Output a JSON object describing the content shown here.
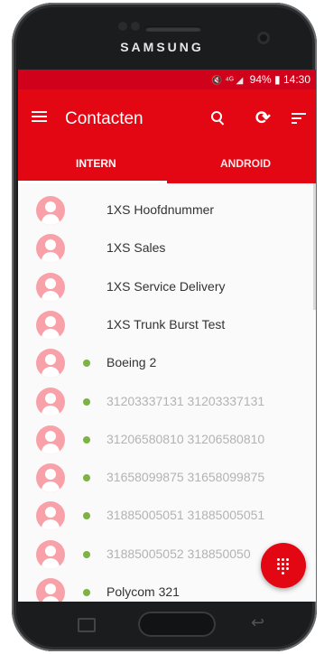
{
  "device": {
    "brand": "SAMSUNG"
  },
  "statusbar": {
    "icons": "🔇 ⁴ᴳ ◢",
    "battery": "94%",
    "battery_icon": "▮",
    "time": "14:30"
  },
  "appbar": {
    "title": "Contacten"
  },
  "tabs": [
    {
      "label": "INTERN",
      "selected": true
    },
    {
      "label": "ANDROID",
      "selected": false
    }
  ],
  "contacts": [
    {
      "name": "1XS Hoofdnummer",
      "presence": false,
      "muted": false
    },
    {
      "name": "1XS Sales",
      "presence": false,
      "muted": false
    },
    {
      "name": "1XS Service Delivery",
      "presence": false,
      "muted": false
    },
    {
      "name": "1XS Trunk Burst Test",
      "presence": false,
      "muted": false
    },
    {
      "name": "Boeing 2",
      "presence": true,
      "muted": false
    },
    {
      "name": "31203337131 31203337131",
      "presence": true,
      "muted": true
    },
    {
      "name": "31206580810 31206580810",
      "presence": true,
      "muted": true
    },
    {
      "name": "31658099875 31658099875",
      "presence": true,
      "muted": true
    },
    {
      "name": "31885005051 31885005051",
      "presence": true,
      "muted": true
    },
    {
      "name": "31885005052 318850050",
      "presence": true,
      "muted": true
    },
    {
      "name": "Polycom 321",
      "presence": true,
      "muted": false
    }
  ],
  "colors": {
    "brand_red": "#e30613",
    "status_red": "#d0021b",
    "avatar_pink": "#f8a1a9",
    "presence_green": "#7cb342"
  },
  "icons": {
    "menu": "hamburger-icon",
    "search": "search-icon",
    "refresh": "refresh-icon",
    "sort": "sort-icon",
    "fab": "dialpad-icon"
  }
}
